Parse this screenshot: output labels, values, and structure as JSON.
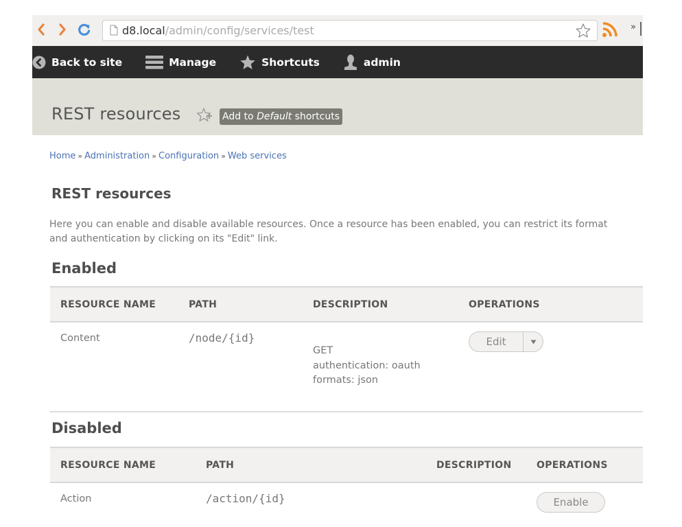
{
  "browser": {
    "url_host": "d8.local",
    "url_path": "/admin/config/services/test",
    "overflow_label": "»"
  },
  "toolbar": {
    "items": [
      {
        "label": "Back to site",
        "icon": "back-arrow-icon"
      },
      {
        "label": "Manage",
        "icon": "menu-icon"
      },
      {
        "label": "Shortcuts",
        "icon": "star-icon"
      },
      {
        "label": "admin",
        "icon": "user-icon"
      }
    ]
  },
  "header": {
    "title": "REST resources",
    "shortcut_prefix": "Add to ",
    "shortcut_set": "Default",
    "shortcut_suffix": " shortcuts"
  },
  "breadcrumb": {
    "items": [
      "Home",
      "Administration",
      "Configuration",
      "Web services"
    ],
    "separator": "»"
  },
  "main": {
    "title": "REST resources",
    "intro": "Here you can enable and disable available resources. Once a resource has been enabled, you can restrict its format and authentication by clicking on its \"Edit\" link."
  },
  "enabled": {
    "heading": "Enabled",
    "columns": [
      "RESOURCE NAME",
      "PATH",
      "DESCRIPTION",
      "OPERATIONS"
    ],
    "rows": [
      {
        "name": "Content",
        "path": "/node/{id}",
        "description": [
          "GET",
          "authentication: oauth",
          "formats: json"
        ],
        "operation": "Edit"
      }
    ]
  },
  "disabled": {
    "heading": "Disabled",
    "columns": [
      "RESOURCE NAME",
      "PATH",
      "DESCRIPTION",
      "OPERATIONS"
    ],
    "rows": [
      {
        "name": "Action",
        "path": "/action/{id}",
        "description": "",
        "operation": "Enable"
      }
    ]
  },
  "colors": {
    "toolbar_bg": "#2b2b2b",
    "header_bg": "#e0e0d8",
    "link": "#4a72b4",
    "nav_arrow": "#e8843f",
    "reload": "#4a90d9",
    "rss": "#f08c1e"
  }
}
